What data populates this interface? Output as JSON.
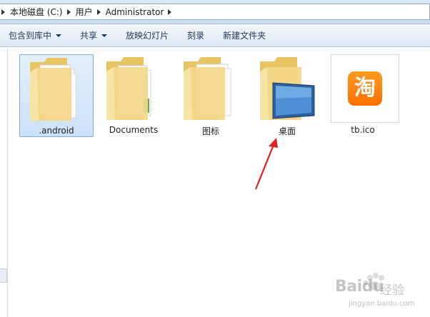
{
  "address_bar": {
    "crumbs": [
      "本地磁盘 (C:)",
      "用户",
      "Administrator"
    ]
  },
  "toolbar": {
    "items": [
      {
        "label": "包含到库中",
        "has_dropdown": true
      },
      {
        "label": "共享",
        "has_dropdown": true
      },
      {
        "label": "放映幻灯片",
        "has_dropdown": false
      },
      {
        "label": "刻录",
        "has_dropdown": false
      },
      {
        "label": "新建文件夹",
        "has_dropdown": false
      }
    ]
  },
  "files": [
    {
      "name": ".android",
      "kind": "folder-with-documents",
      "selected": true
    },
    {
      "name": "Documents",
      "kind": "folder-with-documents",
      "selected": false
    },
    {
      "name": "图标",
      "kind": "folder-with-documents",
      "selected": false
    },
    {
      "name": "桌面",
      "kind": "desktop-folder",
      "selected": false
    },
    {
      "name": "tb.ico",
      "kind": "icon-file",
      "selected": false,
      "glyph": "淘"
    }
  ],
  "annotation": {
    "color": "#e02020",
    "icon": "red-arrow-pointing-up"
  },
  "watermark": {
    "brand": "Bai",
    "brand_tail": "du",
    "sub": "经验",
    "url": "jingyan.baidu.com"
  },
  "colors": {
    "selection": "#cce1fa",
    "folder": "#f1d27a",
    "taobao_orange": "#ff7a00"
  }
}
